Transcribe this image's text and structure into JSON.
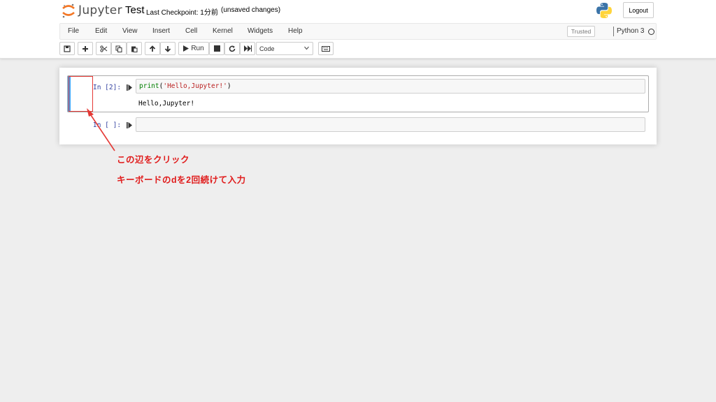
{
  "header": {
    "logo_text": "Jupyter",
    "notebook_title": "Test",
    "checkpoint": "Last Checkpoint: 1分前",
    "unsaved": "(unsaved changes)",
    "logout_label": "Logout"
  },
  "menubar": {
    "items": [
      "File",
      "Edit",
      "View",
      "Insert",
      "Cell",
      "Kernel",
      "Widgets",
      "Help"
    ],
    "trusted_label": "Trusted",
    "kernel_name": "Python 3"
  },
  "toolbar": {
    "run_label": "Run",
    "cell_type": "Code",
    "icons": [
      "save-icon",
      "plus-icon",
      "scissors-icon",
      "copy-icon",
      "paste-icon",
      "arrow-up-icon",
      "arrow-down-icon",
      "play-icon",
      "stop-icon",
      "restart-icon",
      "fast-forward-icon",
      "keyboard-icon"
    ]
  },
  "cells": [
    {
      "prompt": "In [2]:",
      "code_func": "print",
      "code_paren_open": "(",
      "code_string": "'Hello,Jupyter!'",
      "code_paren_close": ")",
      "output": "Hello,Jupyter!"
    },
    {
      "prompt": "In [ ]:",
      "code": ""
    }
  ],
  "annotation": {
    "line1": "この辺をクリック",
    "line2": "キーボードのdを2回続けて入力",
    "color": "#e01b1b"
  },
  "colors": {
    "selected_cell_bar": "#42a5f5",
    "prompt": "#303f9f",
    "jupyter_orange": "#f37726"
  }
}
